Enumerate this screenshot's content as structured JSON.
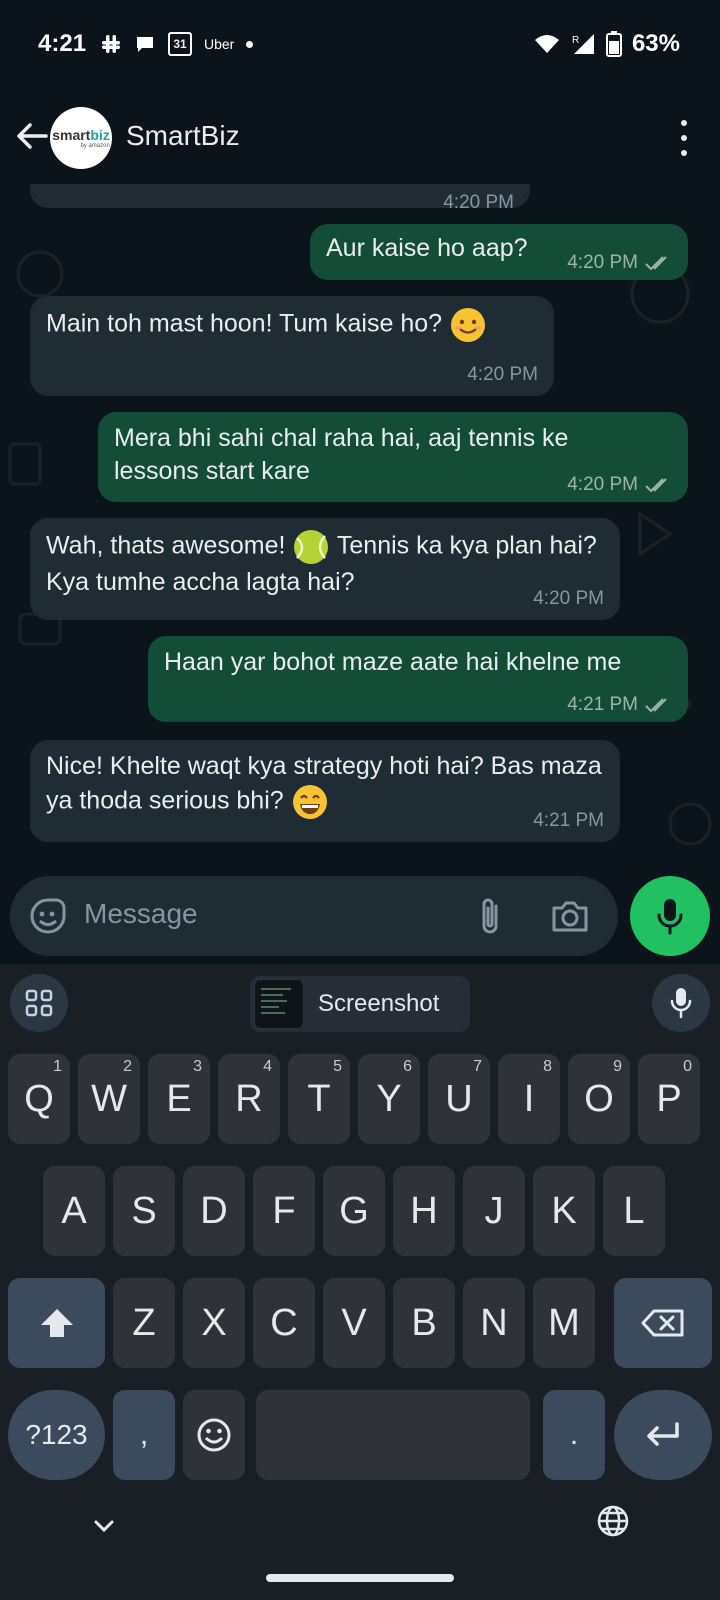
{
  "status_bar": {
    "time": "4:21",
    "calendar_day": "31",
    "uber": "Uber",
    "signal_r": "R",
    "battery": "63%"
  },
  "header": {
    "title": "SmartBiz",
    "avatar_brand_a": "smart",
    "avatar_brand_b": "biz",
    "avatar_sub": "by amazon"
  },
  "messages": [
    {
      "dir": "in",
      "text": "",
      "time": "4:20 PM"
    },
    {
      "dir": "out",
      "text": "Aur kaise ho aap?",
      "time": "4:20 PM"
    },
    {
      "dir": "in",
      "text": "Main toh mast hoon! Tum kaise ho?",
      "time": "4:20 PM"
    },
    {
      "dir": "out",
      "text": "Mera bhi sahi chal raha hai, aaj tennis ke lessons start kare",
      "time": "4:20 PM"
    },
    {
      "dir": "in",
      "text_a": "Wah, thats awesome!",
      "text_b": "Tennis ka kya plan hai? Kya tumhe accha lagta hai?",
      "time": "4:20 PM"
    },
    {
      "dir": "out",
      "text": "Haan yar bohot maze aate hai khelne me",
      "time": "4:21 PM"
    },
    {
      "dir": "in",
      "text": "Nice! Khelte waqt kya strategy hoti hai? Bas maza ya thoda serious bhi?",
      "time": "4:21 PM"
    }
  ],
  "composer": {
    "placeholder": "Message"
  },
  "keyboard": {
    "suggestion": "Screenshot",
    "row1": [
      "Q",
      "W",
      "E",
      "R",
      "T",
      "Y",
      "U",
      "I",
      "O",
      "P"
    ],
    "row1_nums": [
      "1",
      "2",
      "3",
      "4",
      "5",
      "6",
      "7",
      "8",
      "9",
      "0"
    ],
    "row2": [
      "A",
      "S",
      "D",
      "F",
      "G",
      "H",
      "J",
      "K",
      "L"
    ],
    "row3": [
      "Z",
      "X",
      "C",
      "V",
      "B",
      "N",
      "M"
    ],
    "symbols": "?123",
    "comma": ",",
    "period": "."
  },
  "colors": {
    "incoming_bubble": "#1f2c34",
    "outgoing_bubble": "#144d37",
    "accent": "#21c063"
  }
}
